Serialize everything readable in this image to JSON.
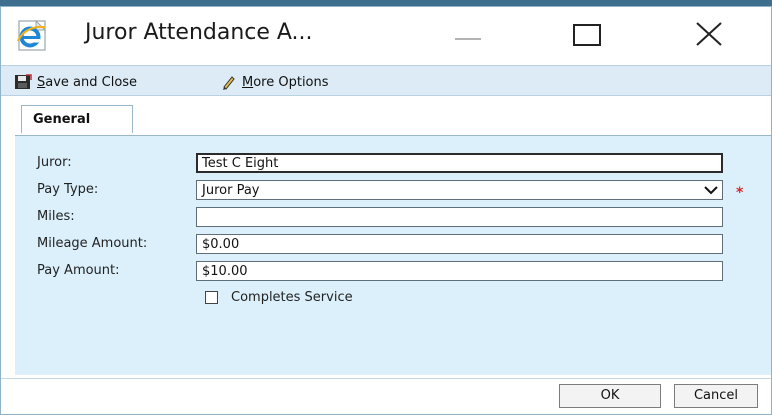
{
  "window": {
    "title": "Juror Attendance A...",
    "icons": {
      "app": "internet-explorer-icon",
      "minimize": "minimize-icon",
      "maximize": "maximize-icon",
      "close": "close-icon"
    }
  },
  "toolbar": {
    "save_close_label": "Save and Close",
    "more_options_label": "More Options",
    "icons": {
      "save": "save-icon",
      "more": "pencil-icon"
    }
  },
  "tabs": [
    {
      "label": "General",
      "active": true
    }
  ],
  "form": {
    "juror": {
      "label": "Juror:",
      "value": "Test C Eight"
    },
    "pay_type": {
      "label": "Pay Type:",
      "value": "Juror Pay",
      "required_marker": "*"
    },
    "miles": {
      "label": "Miles:",
      "value": ""
    },
    "mileage_amount": {
      "label": "Mileage Amount:",
      "value": "$0.00"
    },
    "pay_amount": {
      "label": "Pay Amount:",
      "value": "$10.00"
    },
    "completes_service": {
      "label": "Completes Service",
      "checked": false
    }
  },
  "footer": {
    "ok_label": "OK",
    "cancel_label": "Cancel"
  },
  "colors": {
    "toolbar_bg": "#dcebf5",
    "panel_bg": "#dcf0fb",
    "required": "#d9232a",
    "ie_blue": "#1e88d6"
  }
}
